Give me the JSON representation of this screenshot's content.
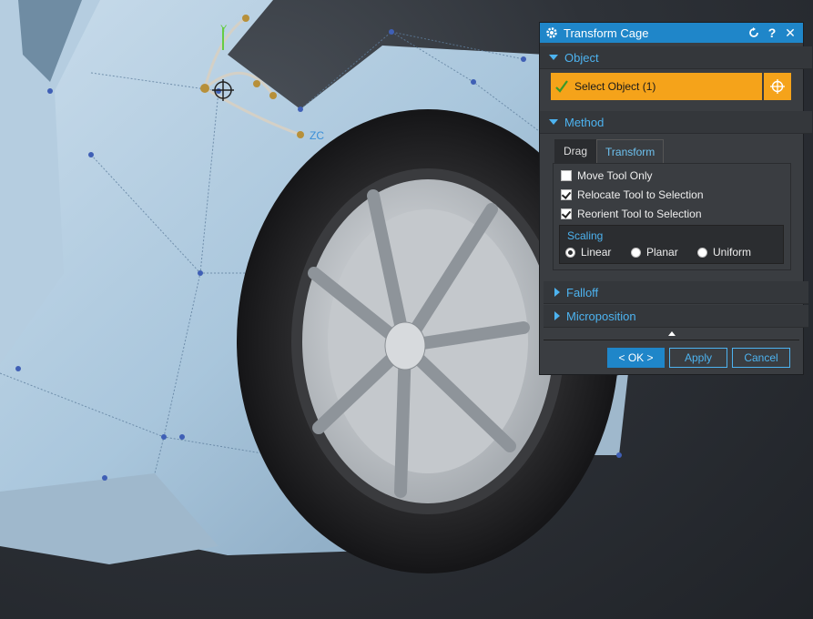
{
  "viewport": {
    "axis_label_y": "Y",
    "axis_label_z": "ZC"
  },
  "dialog": {
    "title": "Transform Cage",
    "icons": [
      "gear-icon",
      "reset-icon",
      "help-icon",
      "close-icon"
    ],
    "sections": {
      "object": {
        "label": "Object",
        "expanded": true,
        "select_label": "Select Object (1)"
      },
      "method": {
        "label": "Method",
        "expanded": true,
        "tabs": [
          "Drag",
          "Transform"
        ],
        "active_tab": "Transform",
        "options": [
          {
            "label": "Move Tool Only",
            "checked": false
          },
          {
            "label": "Relocate Tool to Selection",
            "checked": true
          },
          {
            "label": "Reorient Tool to Selection",
            "checked": true
          }
        ],
        "scaling": {
          "label": "Scaling",
          "choices": [
            "Linear",
            "Planar",
            "Uniform"
          ],
          "selected": "Linear"
        }
      },
      "falloff": {
        "label": "Falloff",
        "expanded": false
      },
      "microposition": {
        "label": "Microposition",
        "expanded": false
      }
    },
    "buttons": {
      "ok": "< OK >",
      "apply": "Apply",
      "cancel": "Cancel"
    },
    "colors": {
      "title": "#1f86c9",
      "accent": "#4db3f0",
      "select": "#f5a31a"
    }
  }
}
